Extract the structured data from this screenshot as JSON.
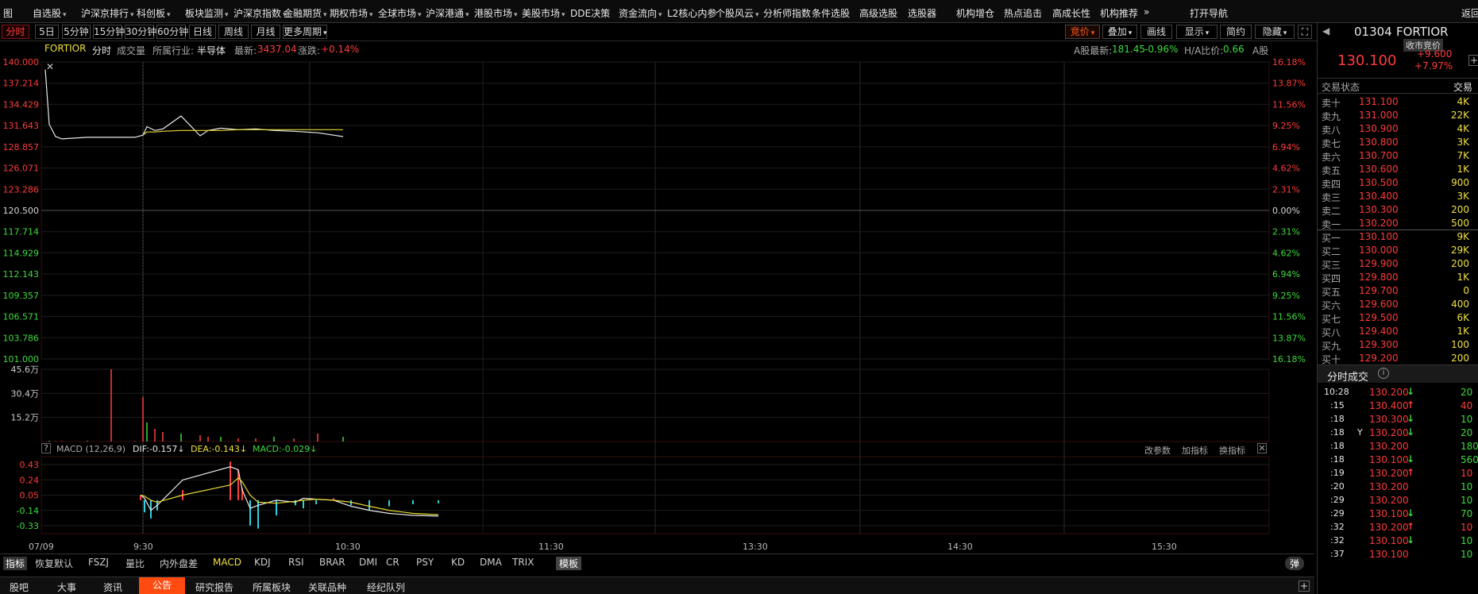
{
  "menu": {
    "items": [
      {
        "label": "图",
        "arrow": false
      },
      {
        "label": "自选股",
        "arrow": true
      },
      {
        "label": "沪深京排行",
        "arrow": true
      },
      {
        "label": "科创板",
        "arrow": true
      },
      {
        "label": "板块监测",
        "arrow": true
      },
      {
        "label": "沪深京指数",
        "arrow": true
      },
      {
        "label": "金融期货",
        "arrow": true
      },
      {
        "label": "期权市场",
        "arrow": true
      },
      {
        "label": "全球市场",
        "arrow": true
      },
      {
        "label": "沪深港通",
        "arrow": true
      },
      {
        "label": "港股市场",
        "arrow": true
      },
      {
        "label": "美股市场",
        "arrow": true
      },
      {
        "label": "DDE决策",
        "arrow": false
      },
      {
        "label": "资金流向",
        "arrow": true
      },
      {
        "label": "L2核心内参",
        "arrow": false
      },
      {
        "label": "个股风云",
        "arrow": true
      },
      {
        "label": "分析师指数",
        "arrow": false
      },
      {
        "label": "条件选股",
        "arrow": false
      },
      {
        "label": "高级选股",
        "arrow": false
      },
      {
        "label": "选股器",
        "arrow": false
      },
      {
        "label": "机构增仓",
        "arrow": false
      },
      {
        "label": "热点追击",
        "arrow": false
      },
      {
        "label": "高成长性",
        "arrow": false
      },
      {
        "label": "机构推荐",
        "arrow": false
      },
      {
        "label": "»",
        "arrow": false
      },
      {
        "label": "打开导航",
        "arrow": false
      },
      {
        "label": "返回",
        "arrow": false
      }
    ]
  },
  "toolbar": {
    "periods": [
      "分时",
      "5日",
      "5分钟",
      "15分钟",
      "30分钟",
      "60分钟",
      "日线",
      "周线",
      "月线",
      "更多周期"
    ],
    "right": [
      "竞价",
      "叠加",
      "画线",
      "显示",
      "简约",
      "隐藏"
    ]
  },
  "info": {
    "name": "FORTIOR",
    "period": "分时",
    "volume": "成交量",
    "industry_label": "所属行业:",
    "industry": "半导体",
    "latest_label": "最新:",
    "latest": "3437.04",
    "change_label": "涨跌:",
    "change": "+0.14%",
    "a_latest_label": "A股最新:",
    "a_latest": "181.45",
    "a_change": "-0.96%",
    "ha_label": "H/A比价:",
    "ha": "0.66",
    "a_badge": "A股"
  },
  "price_axis": {
    "left": [
      "140.000",
      "137.214",
      "134.429",
      "131.643",
      "128.857",
      "126.071",
      "123.286",
      "120.500",
      "117.714",
      "114.929",
      "112.143",
      "109.357",
      "106.571",
      "103.786",
      "101.000"
    ],
    "right": [
      "16.18%",
      "13.87%",
      "11.56%",
      "9.25%",
      "6.94%",
      "4.62%",
      "2.31%",
      "0.00%",
      "2.31%",
      "4.62%",
      "6.94%",
      "9.25%",
      "11.56%",
      "13.87%",
      "16.18%"
    ]
  },
  "volume_axis": [
    "45.6万",
    "30.4万",
    "15.2万"
  ],
  "macd": {
    "title": "MACD (12,26,9)",
    "dif": "DIF:-0.157",
    "dea": "DEA:-0.143",
    "macd": "MACD:-0.029",
    "buttons": [
      "改参数",
      "加指标",
      "换指标"
    ],
    "axis": [
      "0.43",
      "0.24",
      "0.05",
      "-0.14",
      "-0.33"
    ]
  },
  "time_axis": [
    "07/09",
    "9:30",
    "10:30",
    "11:30",
    "13:30",
    "14:30",
    "15:30"
  ],
  "chart_data": {
    "type": "line",
    "title": "",
    "xlabel": "",
    "ylabel": "",
    "ylim": [
      101.0,
      140.0
    ],
    "x": [
      "9:20",
      "9:21",
      "9:22",
      "9:23",
      "9:24",
      "9:25",
      "9:30",
      "9:32",
      "9:35",
      "9:40",
      "9:45",
      "9:50",
      "9:55",
      "10:00",
      "10:05",
      "10:10",
      "10:15",
      "10:20",
      "10:25",
      "10:28"
    ],
    "series": [
      {
        "values": [
          139.0,
          131.8,
          130.2,
          129.9,
          130.1,
          130.1,
          130.4,
          131.5,
          131.0,
          131.2,
          132.9,
          130.3,
          131.0,
          131.3,
          131.1,
          131.2,
          131.0,
          130.9,
          130.7,
          130.2
        ]
      },
      {
        "values": [
          null,
          null,
          null,
          null,
          null,
          null,
          130.4,
          130.8,
          130.8,
          130.9,
          131.0,
          131.0,
          131.0,
          131.0,
          131.1,
          131.1,
          131.1,
          131.1,
          131.1,
          131.1
        ]
      }
    ],
    "volume": {
      "ylim": [
        0,
        45.6
      ],
      "values": [
        45.6,
        0.5,
        0.2,
        0.3,
        0.4,
        0.3,
        28,
        12,
        8,
        6,
        5,
        4,
        3,
        3,
        2,
        2,
        3,
        2,
        5,
        3
      ]
    },
    "macd": {
      "ylim": [
        -0.33,
        0.43
      ],
      "hist": [
        0.05,
        -0.12,
        -0.18,
        -0.1,
        0.1,
        0.38,
        0.3,
        0.12,
        -0.25,
        -0.28,
        -0.15,
        -0.05,
        -0.08,
        -0.04,
        0.02,
        -0.05,
        -0.1,
        -0.06,
        -0.04,
        -0.03
      ],
      "dif": [
        0.05,
        0.02,
        -0.1,
        -0.05,
        0.2,
        0.33,
        0.3,
        0.1,
        -0.08,
        -0.05,
        0.0,
        -0.02,
        0.02,
        0.01,
        0.0,
        -0.06,
        -0.1,
        -0.13,
        -0.15,
        -0.157
      ],
      "dea": [
        0.05,
        0.04,
        0.0,
        -0.02,
        0.05,
        0.15,
        0.22,
        0.18,
        0.05,
        -0.02,
        -0.03,
        -0.01,
        0.0,
        0.01,
        0.0,
        -0.02,
        -0.06,
        -0.1,
        -0.13,
        -0.143
      ]
    }
  },
  "bottom_tabs": [
    "指标",
    "恢复默认",
    "FSZJ",
    "量比",
    "内外盘差",
    "MACD",
    "KDJ",
    "RSI",
    "BRAR",
    "DMI",
    "CR",
    "PSY",
    "KD",
    "DMA",
    "TRIX",
    "模板",
    "弹"
  ],
  "footer": [
    "股吧",
    "大事",
    "资讯",
    "公告",
    "研究报告",
    "所属板块",
    "关联品种",
    "经纪队列"
  ],
  "side": {
    "code": "01304",
    "name": "FORTIOR",
    "sub": "收市竞价",
    "price": "130.100",
    "change": "+9.600",
    "pct": "+7.97%",
    "status_label": "交易状态",
    "status_right": "交易",
    "asks": [
      [
        "卖十",
        "131.100",
        "4K"
      ],
      [
        "卖九",
        "131.000",
        "22K"
      ],
      [
        "卖八",
        "130.900",
        "4K"
      ],
      [
        "卖七",
        "130.800",
        "3K"
      ],
      [
        "卖六",
        "130.700",
        "7K"
      ],
      [
        "卖五",
        "130.600",
        "1K"
      ],
      [
        "卖四",
        "130.500",
        "900"
      ],
      [
        "卖三",
        "130.400",
        "3K"
      ],
      [
        "卖二",
        "130.300",
        "200"
      ],
      [
        "卖一",
        "130.200",
        "500"
      ]
    ],
    "bids": [
      [
        "买一",
        "130.100",
        "9K"
      ],
      [
        "买二",
        "130.000",
        "29K"
      ],
      [
        "买三",
        "129.900",
        "200"
      ],
      [
        "买四",
        "129.800",
        "1K"
      ],
      [
        "买五",
        "129.700",
        "0"
      ],
      [
        "买六",
        "129.600",
        "400"
      ],
      [
        "买七",
        "129.500",
        "6K"
      ],
      [
        "买八",
        "129.400",
        "1K"
      ],
      [
        "买九",
        "129.300",
        "100"
      ],
      [
        "买十",
        "129.200",
        "200"
      ]
    ],
    "trades_title": "分时成交",
    "trades": [
      [
        "10:28",
        "",
        "130.200",
        "down",
        "20"
      ],
      [
        ":15",
        "",
        "130.400",
        "up",
        "40"
      ],
      [
        ":18",
        "",
        "130.300",
        "down",
        "10"
      ],
      [
        ":18",
        "Y",
        "130.200",
        "down",
        "20"
      ],
      [
        ":18",
        "",
        "130.200",
        "",
        "180"
      ],
      [
        ":18",
        "",
        "130.100",
        "down",
        "560"
      ],
      [
        ":19",
        "",
        "130.200",
        "up",
        "10"
      ],
      [
        ":20",
        "",
        "130.200",
        "",
        "10"
      ],
      [
        ":29",
        "",
        "130.200",
        "",
        "10"
      ],
      [
        ":29",
        "",
        "130.100",
        "down",
        "70"
      ],
      [
        ":32",
        "",
        "130.200",
        "up",
        "10"
      ],
      [
        ":32",
        "",
        "130.100",
        "down",
        "10"
      ],
      [
        ":37",
        "",
        "130.100",
        "",
        "10"
      ]
    ]
  }
}
